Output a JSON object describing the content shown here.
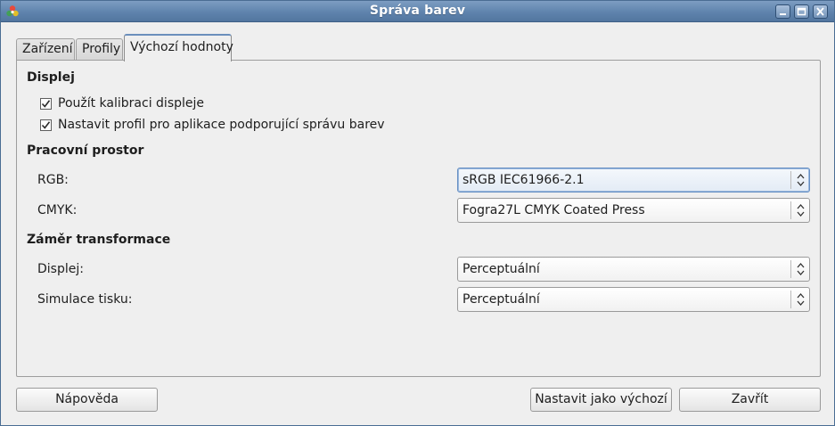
{
  "window": {
    "title": "Správa barev",
    "icon": "color-management-app-icon",
    "controls": [
      "minimize-icon",
      "maximize-icon",
      "close-icon"
    ]
  },
  "tabs": [
    {
      "label": "Zařízení",
      "active": false
    },
    {
      "label": "Profily",
      "active": false
    },
    {
      "label": "Výchozí hodnoty",
      "active": true
    }
  ],
  "display_section": {
    "title": "Displej",
    "use_calibration": {
      "label": "Použít kalibraci displeje",
      "checked": true
    },
    "set_profile": {
      "label": "Nastavit profil pro aplikace podporující správu barev",
      "checked": true
    }
  },
  "workspace_section": {
    "title": "Pracovní prostor",
    "rgb": {
      "label": "RGB:",
      "value": "sRGB IEC61966-2.1"
    },
    "cmyk": {
      "label": "CMYK:",
      "value": "Fogra27L CMYK Coated Press"
    }
  },
  "intent_section": {
    "title": "Záměr transformace",
    "display": {
      "label": "Displej:",
      "value": "Perceptuální"
    },
    "print_sim": {
      "label": "Simulace tisku:",
      "value": "Perceptuální"
    }
  },
  "buttons": {
    "help": "Nápověda",
    "set_default": "Nastavit jako výchozí",
    "close": "Zavřít"
  },
  "colors": {
    "titlebar": "#5f83ad",
    "accent": "#6b8fbc",
    "window_bg": "#efefef"
  }
}
